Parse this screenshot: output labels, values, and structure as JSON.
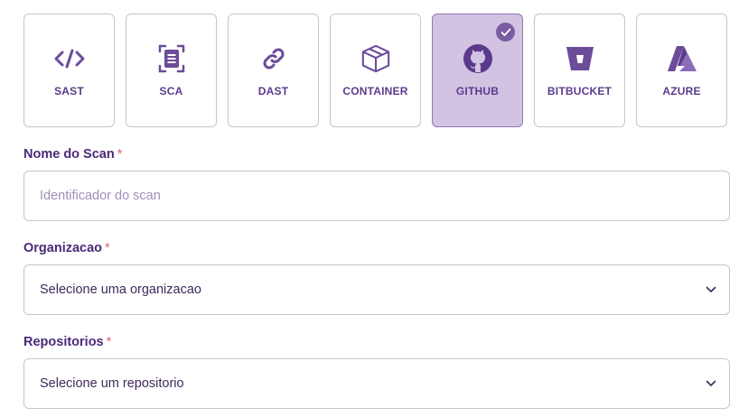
{
  "scan_types": [
    {
      "label": "SAST",
      "icon": "code-icon",
      "selected": false
    },
    {
      "label": "SCA",
      "icon": "document-scan-icon",
      "selected": false
    },
    {
      "label": "DAST",
      "icon": "link-icon",
      "selected": false
    },
    {
      "label": "CONTAINER",
      "icon": "box-icon",
      "selected": false
    },
    {
      "label": "GITHUB",
      "icon": "github-icon",
      "selected": true
    },
    {
      "label": "BITBUCKET",
      "icon": "bitbucket-icon",
      "selected": false
    },
    {
      "label": "AZURE",
      "icon": "azure-icon",
      "selected": false
    }
  ],
  "form": {
    "scan_name": {
      "label": "Nome do Scan",
      "required_mark": "*",
      "placeholder": "Identificador do scan",
      "value": ""
    },
    "organization": {
      "label": "Organizacao",
      "required_mark": "*",
      "selected": "Selecione uma organizacao"
    },
    "repositories": {
      "label": "Repositorios",
      "required_mark": "*",
      "selected": "Selecione um repositorio"
    }
  },
  "colors": {
    "accent": "#6b4c9a",
    "selected_bg": "#d2c3e3",
    "border": "#c9c3d3",
    "required": "#e0607a"
  }
}
